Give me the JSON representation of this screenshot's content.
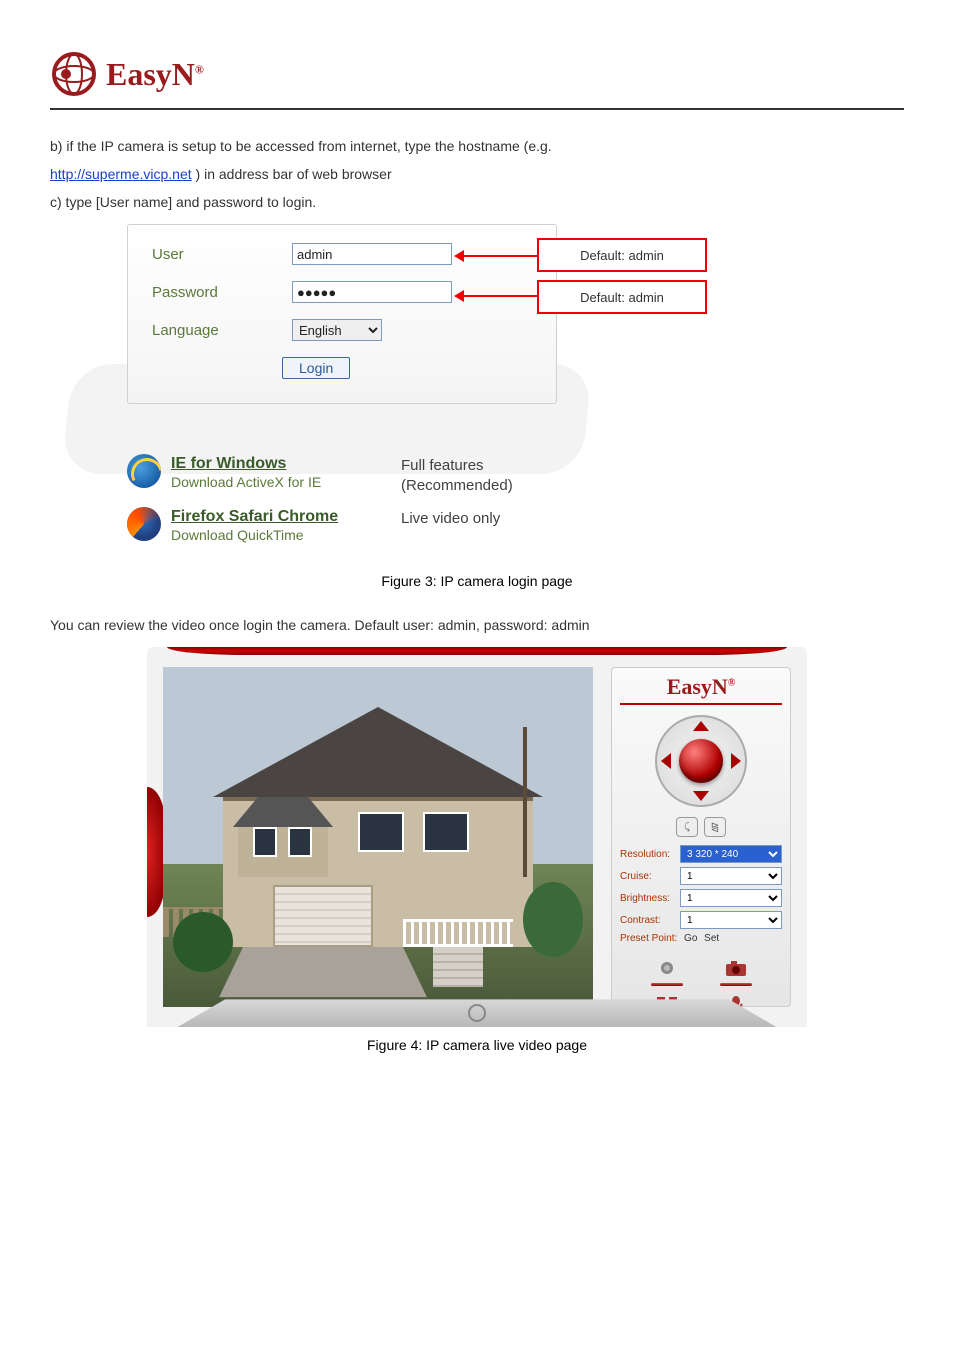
{
  "logo_text": "EasyN",
  "paragraph": {
    "line1_a": "b",
    "line1_b": " if the IP camera is setup to be accessed from internet, type the hostname (e.g.",
    "line2_link": "http://superme.vicp.net",
    "line2_after": " )  in address bar of web browser",
    "line3_a": "c",
    "line3_b": " type [User name] and password to login."
  },
  "login": {
    "user_label": "User",
    "user_value": "admin",
    "password_label": "Password",
    "password_value": "●●●●●",
    "language_label": "Language",
    "language_value": "English",
    "login_button": "Login"
  },
  "annotations": {
    "user_note": "Default: admin",
    "pass_note": "Default: admin"
  },
  "browsers": {
    "ie_title": "IE for Windows",
    "ie_sub": "Download ActiveX for IE",
    "ie_desc_1": "Full features",
    "ie_desc_2": "(Recommended)",
    "ff_title": "Firefox Safari Chrome",
    "ff_sub": "Download QuickTime",
    "ff_desc": "Live video only"
  },
  "caption_login": "Figure 3: IP camera login page",
  "footnote": "You can review the video once login the camera. Default user: admin, password: admin",
  "caption_viewer": "Figure 4: IP camera live video page",
  "controls": {
    "logo": "EasyN",
    "resolution_label": "Resolution:",
    "resolution_value": "3 320 * 240",
    "cruise_label": "Cruise:",
    "cruise_value": "1",
    "brightness_label": "Brightness:",
    "brightness_value": "1",
    "contrast_label": "Contrast:",
    "contrast_value": "1",
    "preset_label": "Preset Point:",
    "preset_go": "Go",
    "preset_set": "Set"
  }
}
